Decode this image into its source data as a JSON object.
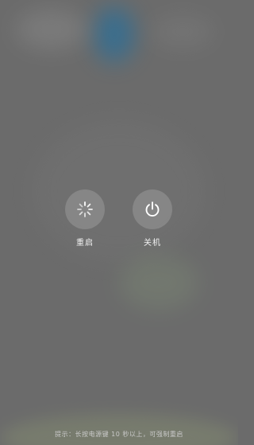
{
  "power_menu": {
    "restart": {
      "label": "重启",
      "icon": "restart-spinner-icon"
    },
    "shutdown": {
      "label": "关机",
      "icon": "power-icon"
    },
    "hint": "提示：长按电源键 10 秒以上，可强制重启"
  },
  "colors": {
    "overlay": "#6b6b6b",
    "button_bg": "rgba(255,255,255,0.16)",
    "text": "#f2f2f2"
  }
}
